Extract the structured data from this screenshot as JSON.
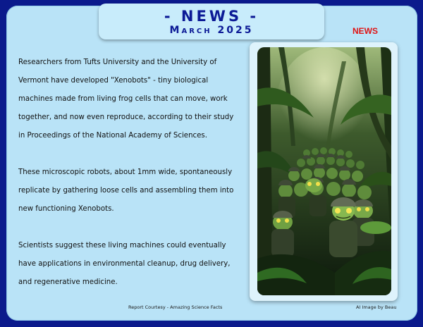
{
  "header": {
    "title": "- NEWS -",
    "date": "March 2025"
  },
  "badge": {
    "label": "NEWS",
    "color": "#e01414"
  },
  "article": {
    "paragraphs": [
      "Researchers from Tufts University and the University of Vermont have developed \"Xenobots\" - tiny biological machines made from living frog cells that can move, work together, and now even reproduce, according to their study in Proceedings of the National Academy of Sciences.",
      "These microscopic robots, about 1mm wide, spontaneously replicate by gathering loose cells and assembling them into new functioning Xenobots.",
      "Scientists suggest these living machines could eventually have applications in environmental cleanup, drug delivery, and regenerative medicine."
    ]
  },
  "footer": {
    "left": "Report Courtesy - Amazing Science Facts",
    "right": "AI Image by Beau"
  },
  "colors": {
    "background": "#0b1a8c",
    "panel": "#b9e3f7",
    "title": "#0c1a96"
  },
  "image": {
    "icon": "jungle-frog-soldiers-illustration"
  }
}
